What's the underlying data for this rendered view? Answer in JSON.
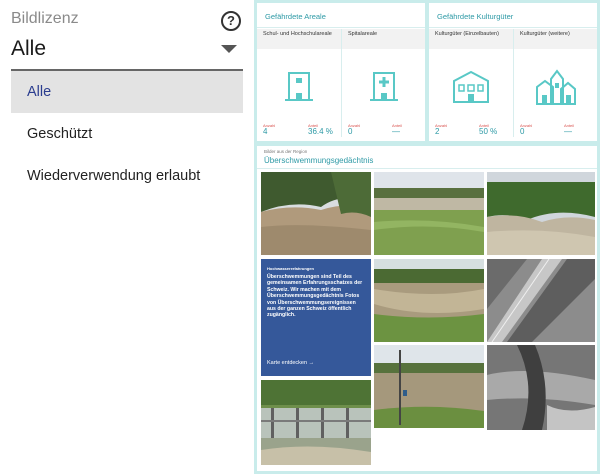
{
  "filter": {
    "label": "Bildlizenz",
    "help_icon": "?",
    "selected_value": "Alle",
    "options": [
      {
        "label": "Alle",
        "selected": true
      },
      {
        "label": "Geschützt",
        "selected": false
      },
      {
        "label": "Wiederverwendung erlaubt",
        "selected": false
      }
    ]
  },
  "cards": {
    "areale": {
      "title": "Gefährdete Areale",
      "cells": [
        {
          "title": "Schul- und Hochschulareale",
          "icon": "school-building-icon",
          "anzahl_label": "Anzahl",
          "anzahl": "4",
          "anteil_label": "Anteil",
          "anteil": "36.4 %"
        },
        {
          "title": "Spitalareale",
          "icon": "hospital-building-icon",
          "anzahl_label": "Anzahl",
          "anzahl": "0",
          "anteil_label": "Anteil",
          "anteil": "—"
        }
      ]
    },
    "kultur": {
      "title": "Gefährdete Kulturgüter",
      "cells": [
        {
          "title": "Kulturgüter (Einzelbauten)",
          "icon": "heritage-building-icon",
          "anzahl_label": "Anzahl",
          "anzahl": "2",
          "anteil_label": "Anteil",
          "anteil": "50 %"
        },
        {
          "title": "Kulturgüter (weitere)",
          "icon": "heritage-town-icon",
          "anzahl_label": "Anzahl",
          "anzahl": "0",
          "anteil_label": "Anteil",
          "anteil": "—"
        }
      ]
    }
  },
  "gallery": {
    "subtitle": "Bilder aus der Region",
    "title": "Überschwemmungsgedächtnis",
    "promo": {
      "kicker": "Hochwassererfahrungen",
      "text": "Überschwemmungen sind Teil des gemeinsamen Erfahrungsschatzes der Schweiz. Wir machen mit dem Überschwemmungsgedächtnis Fotos von Überschwemmungsereignissen aus der ganzen Schweiz öffentlich zugänglich.",
      "link": "Karte entdecken →"
    },
    "photos": [
      "flooded-river-photo",
      "flooded-field-photo",
      "flooded-riverbank-photo",
      "flooded-meadow-photo",
      "aerial-flood-photo",
      "flooded-fence-photo",
      "weir-photo",
      "aerial-flood-photo-2"
    ]
  },
  "colors": {
    "accent": "#2e9aa6",
    "panel_bg": "#c9eceb",
    "promo_bg": "#35589a",
    "selected_text": "#2b3d8f"
  }
}
